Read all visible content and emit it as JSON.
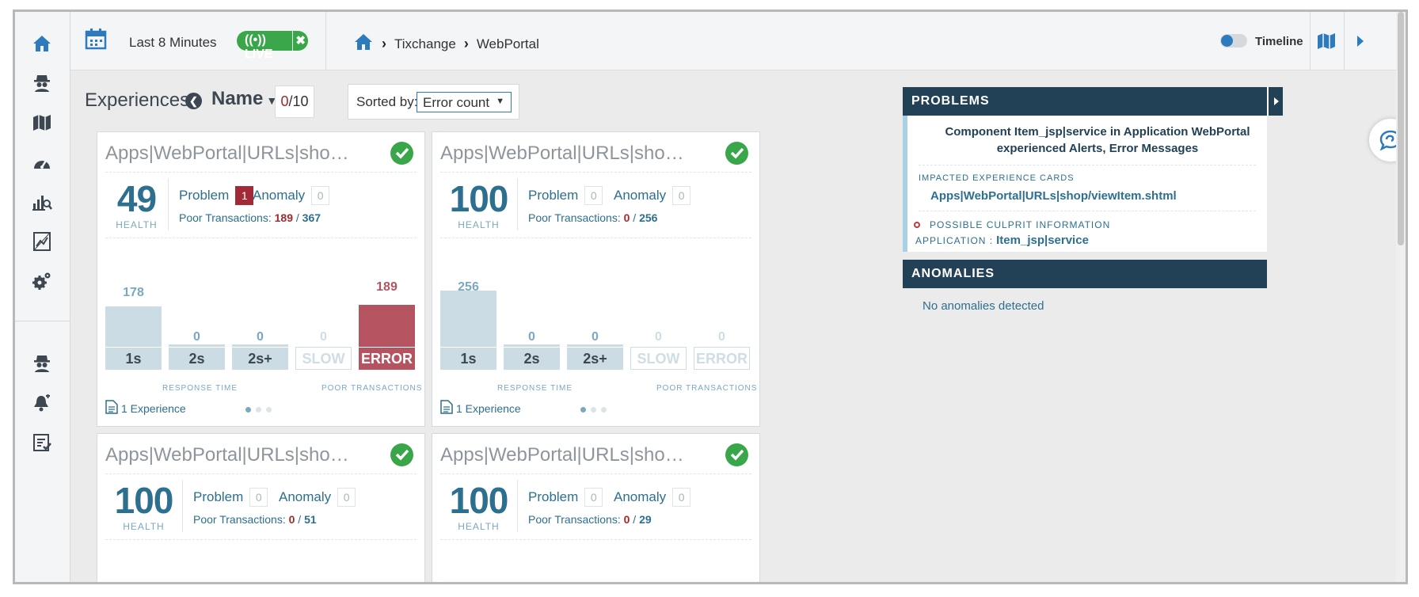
{
  "colors": {
    "accent": "#2d7bbd",
    "live_green": "#3aa64a",
    "error_red": "#a12a36",
    "panel_header": "#234156"
  },
  "nav": [
    "home-icon",
    "agent-icon",
    "map-icon",
    "dashboard-gauge-icon",
    "analytics-icon",
    "reports-icon",
    "settings-icon",
    "agent-secondary-icon",
    "alerts-icon",
    "checklist-icon"
  ],
  "topbar": {
    "time_range": "Last 8 Minutes",
    "live_label": "((•)) LIVE",
    "live_close": "✖",
    "breadcrumb": [
      "Tixchange",
      "WebPortal"
    ],
    "timeline_label": "Timeline"
  },
  "experiences": {
    "title": "Experiences",
    "name_sort": "Name",
    "count_zero": "0",
    "count_total": "/10",
    "sorted_by_label": "Sorted by:",
    "sorted_by_value": "Error count"
  },
  "cards": [
    {
      "name": "Apps|WebPortal|URLs|shop/vie...",
      "health": "49",
      "health_label": "HEALTH",
      "problem_label": "Problem",
      "problem_count": "1",
      "anomaly_label": "Anomaly",
      "anomaly_count": "0",
      "poor_label": "Poor Transactions:",
      "poor_bad": "189",
      "poor_total": "367",
      "bars": [
        {
          "label": "1s",
          "value": "178"
        },
        {
          "label": "2s",
          "value": "0"
        },
        {
          "label": "2s+",
          "value": "0"
        },
        {
          "label": "SLOW",
          "value": "0"
        },
        {
          "label": "ERROR",
          "value": "189"
        }
      ],
      "caption_rt": "RESPONSE TIME",
      "caption_pt": "POOR TRANSACTIONS",
      "experiences": "1 Experience"
    },
    {
      "name": "Apps|WebPortal|URLs|shop/ind...",
      "health": "100",
      "health_label": "HEALTH",
      "problem_label": "Problem",
      "problem_count": "0",
      "anomaly_label": "Anomaly",
      "anomaly_count": "0",
      "poor_label": "Poor Transactions:",
      "poor_bad": "0",
      "poor_total": "256",
      "bars": [
        {
          "label": "1s",
          "value": "256"
        },
        {
          "label": "2s",
          "value": "0"
        },
        {
          "label": "2s+",
          "value": "0"
        },
        {
          "label": "SLOW",
          "value": "0"
        },
        {
          "label": "ERROR",
          "value": "0"
        }
      ],
      "caption_rt": "RESPONSE TIME",
      "caption_pt": "POOR TRANSACTIONS",
      "experiences": "1 Experience"
    },
    {
      "name": "Apps|WebPortal|URLs|shop/ne...",
      "health": "100",
      "health_label": "HEALTH",
      "problem_label": "Problem",
      "problem_count": "0",
      "anomaly_label": "Anomaly",
      "anomaly_count": "0",
      "poor_label": "Poor Transactions:",
      "poor_bad": "0",
      "poor_total": "51"
    },
    {
      "name": "Apps|WebPortal|URLs|shop/ne...",
      "health": "100",
      "health_label": "HEALTH",
      "problem_label": "Problem",
      "problem_count": "0",
      "anomaly_label": "Anomaly",
      "anomaly_count": "0",
      "poor_label": "Poor Transactions:",
      "poor_bad": "0",
      "poor_total": "29"
    }
  ],
  "problems": {
    "header": "PROBLEMS",
    "message": "Component Item_jsp|service in Application WebPortal experienced Alerts, Error Messages",
    "impacted_label": "IMPACTED EXPERIENCE CARDS",
    "impacted_link": "Apps|WebPortal|URLs|shop/viewItem.shtml",
    "culprit_label": "POSSIBLE CULPRIT INFORMATION",
    "application_label": "APPLICATION :",
    "application_value": "Item_jsp|service"
  },
  "anomalies": {
    "header": "ANOMALIES",
    "message": "No anomalies detected"
  }
}
